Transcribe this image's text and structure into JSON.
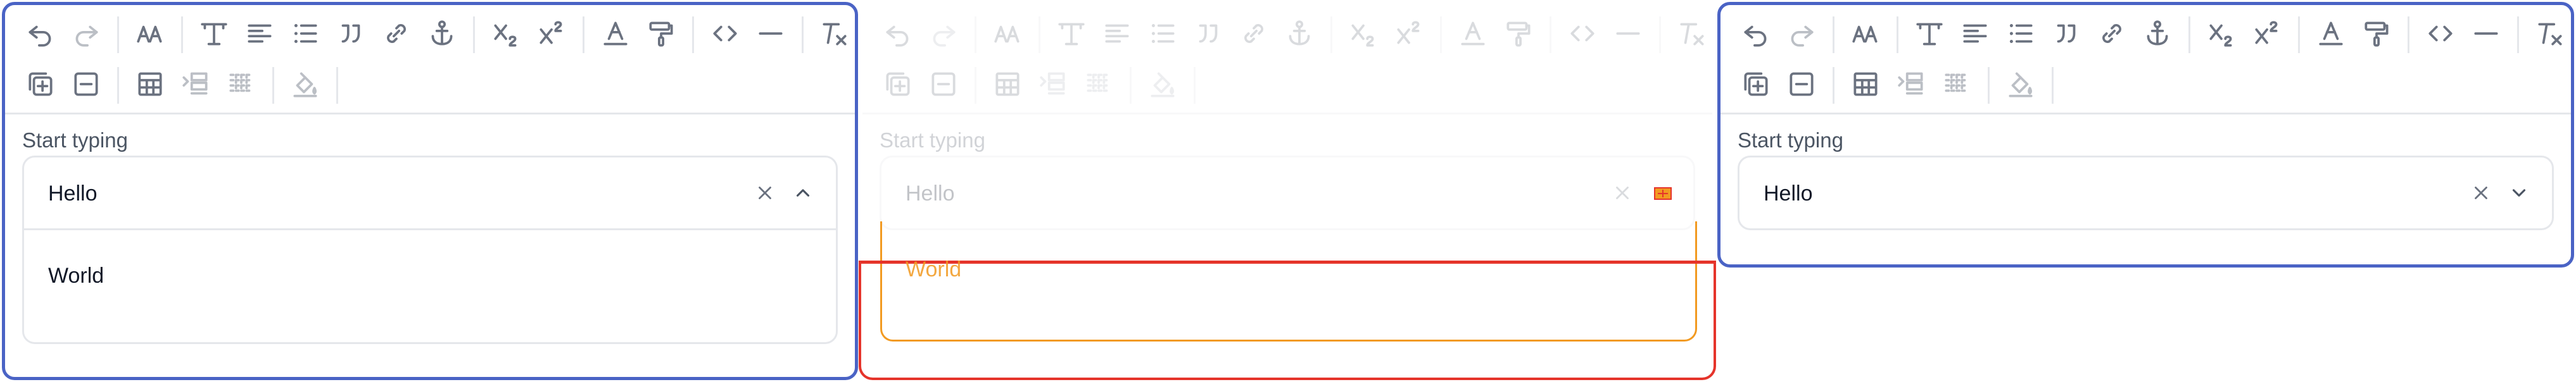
{
  "editor": {
    "field_label": "Start typing",
    "combo_value": "Hello",
    "option_label": "World"
  },
  "toolbar": {
    "row1": [
      {
        "icon": "undo-icon",
        "enabled": true
      },
      {
        "icon": "redo-icon",
        "enabled": false
      },
      {
        "sep": true
      },
      {
        "icon": "font-size-icon",
        "enabled": true
      },
      {
        "sep": true
      },
      {
        "icon": "paragraph-style-icon",
        "enabled": true
      },
      {
        "icon": "align-icon",
        "enabled": true
      },
      {
        "icon": "bulleted-list-icon",
        "enabled": true
      },
      {
        "icon": "blockquote-icon",
        "enabled": true
      },
      {
        "icon": "link-icon",
        "enabled": true
      },
      {
        "icon": "anchor-icon",
        "enabled": true
      },
      {
        "sep": true
      },
      {
        "icon": "subscript-icon",
        "enabled": true
      },
      {
        "icon": "superscript-icon",
        "enabled": true
      },
      {
        "sep": true
      },
      {
        "icon": "text-color-icon",
        "enabled": true
      },
      {
        "icon": "paint-roller-icon",
        "enabled": true
      },
      {
        "sep": true
      },
      {
        "icon": "code-icon",
        "enabled": true
      },
      {
        "icon": "horizontal-rule-icon",
        "enabled": true
      },
      {
        "sep": true
      },
      {
        "icon": "clear-formatting-icon",
        "enabled": true
      }
    ],
    "row2": [
      {
        "icon": "add-box-icon",
        "enabled": true
      },
      {
        "icon": "remove-box-icon",
        "enabled": true
      },
      {
        "sep": true
      },
      {
        "icon": "table-icon",
        "enabled": true
      },
      {
        "icon": "insert-row-icon",
        "enabled": false
      },
      {
        "icon": "delete-row-icon",
        "enabled": false
      },
      {
        "sep": true
      },
      {
        "icon": "fill-color-icon",
        "enabled": false
      },
      {
        "sep": true
      }
    ]
  },
  "colors": {
    "panel_border": "#4a63c5",
    "debug_outline": "#e5342b",
    "debug_accent": "#f29a21",
    "icon": "#6b7280"
  }
}
